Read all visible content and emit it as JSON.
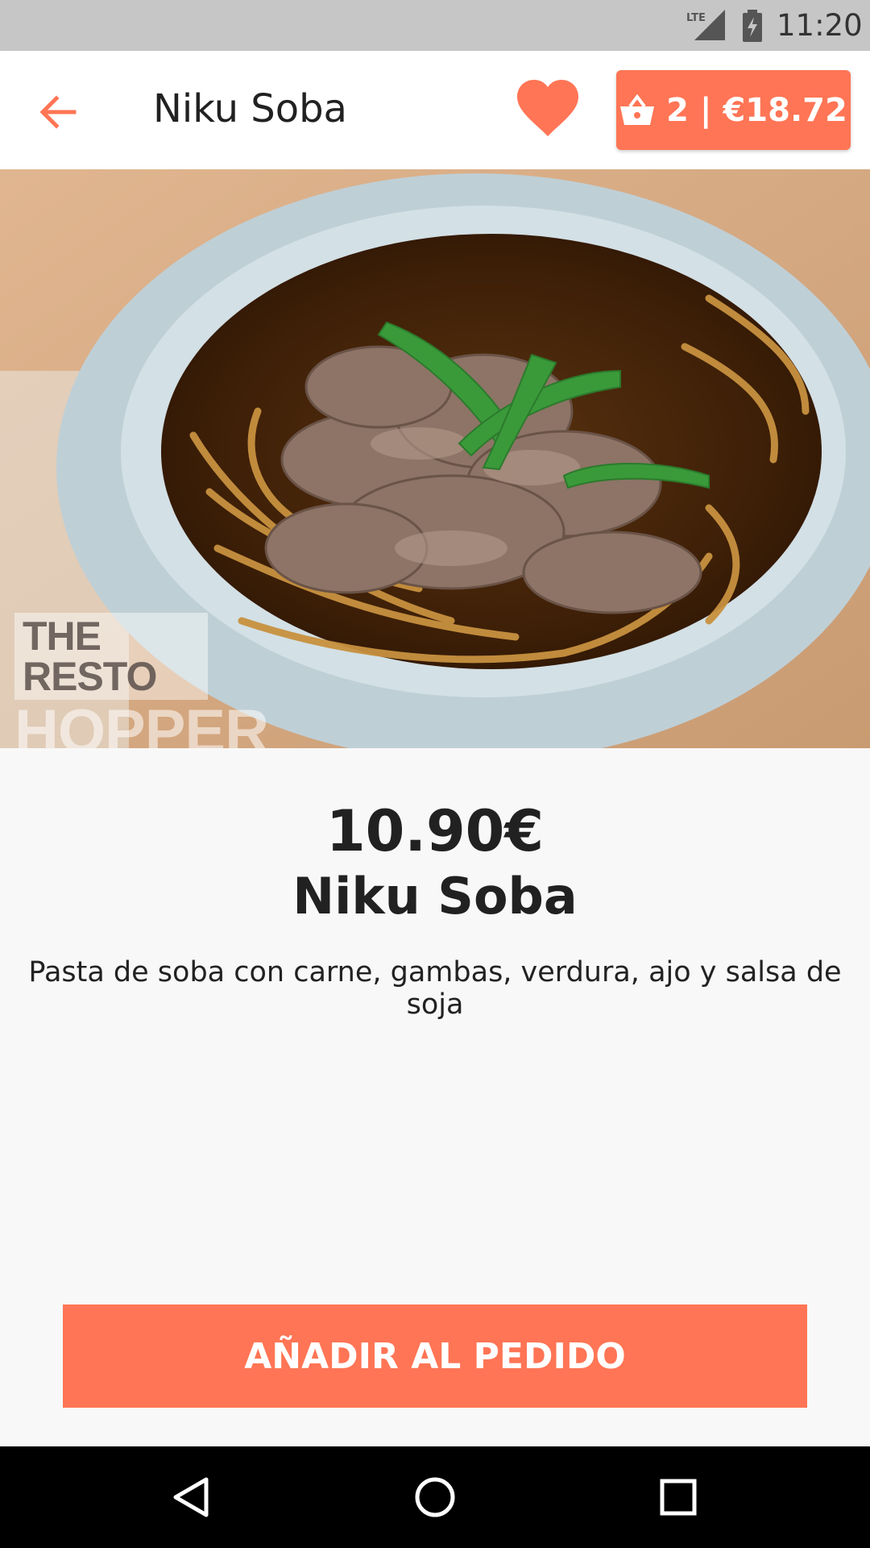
{
  "status_bar": {
    "time": "11:20",
    "network": "LTE",
    "icons": [
      "lte-signal-icon",
      "battery-charging-icon"
    ]
  },
  "app_bar": {
    "back_icon": "arrow-left-icon",
    "title": "Niku Soba",
    "favorite_icon": "heart-icon",
    "cart": {
      "icon": "basket-icon",
      "label": "2 | €18.72"
    }
  },
  "hero_image": {
    "subject": "bowl of niku soba",
    "watermark_line1": "THE RESTO",
    "watermark_line2": "HOPPER"
  },
  "product": {
    "price": "10.90€",
    "name": "Niku Soba",
    "description": "Pasta de soba con carne, gambas, verdura, ajo y salsa de soja"
  },
  "actions": {
    "add_label": "AÑADIR AL PEDIDO"
  },
  "nav_bar": {
    "icons": [
      "back-triangle-icon",
      "home-circle-icon",
      "recents-square-icon"
    ]
  },
  "colors": {
    "accent": "#ff7555",
    "status_bar": "#c6c6c6",
    "nav_bar": "#000000",
    "background": "#f8f8f8"
  }
}
